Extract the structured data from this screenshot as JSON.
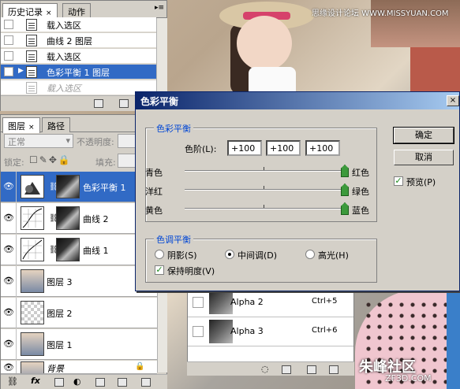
{
  "watermark": {
    "top": "思缘设计论坛 WWW.MISSYUAN.COM",
    "bottom_cn": "朱峰社区",
    "bottom_en": "ZF3D.COM"
  },
  "history": {
    "tabs": [
      {
        "label": "历史记录",
        "close": "×"
      },
      {
        "label": "动作"
      }
    ],
    "items": [
      {
        "label": "载入选区"
      },
      {
        "label": "曲线 2 图层"
      },
      {
        "label": "载入选区"
      },
      {
        "label": "色彩平衡 1 图层"
      },
      {
        "label": "载入选区"
      }
    ]
  },
  "layers": {
    "tabs": [
      {
        "label": "图层",
        "close": "×"
      },
      {
        "label": "路径"
      }
    ],
    "blend_mode": "正常",
    "opacity_label": "不透明度:",
    "lock_label": "锁定:",
    "fill_label": "填充:",
    "items": [
      {
        "name": "色彩平衡 1"
      },
      {
        "name": "曲线 2"
      },
      {
        "name": "曲线 1"
      },
      {
        "name": "图层 3"
      },
      {
        "name": "图层 2"
      },
      {
        "name": "图层 1"
      },
      {
        "name": "背景"
      }
    ]
  },
  "channels": {
    "items": [
      {
        "name": "Alpha 2",
        "shortcut": "Ctrl+5"
      },
      {
        "name": "Alpha 3",
        "shortcut": "Ctrl+6"
      }
    ]
  },
  "dialog": {
    "title": "色彩平衡",
    "close": "×",
    "balance_group": "色彩平衡",
    "levels_label": "色阶(L):",
    "levels": [
      "+100",
      "+100",
      "+100"
    ],
    "sliders": [
      {
        "left": "青色",
        "right": "红色",
        "value": 100
      },
      {
        "left": "洋红",
        "right": "绿色",
        "value": 100
      },
      {
        "left": "黄色",
        "right": "蓝色",
        "value": 100
      }
    ],
    "tone_group": "色调平衡",
    "tones": [
      {
        "label": "阴影(S)"
      },
      {
        "label": "中间调(D)",
        "selected": true
      },
      {
        "label": "高光(H)"
      }
    ],
    "preserve_label": "保持明度(V)",
    "preserve_checked": true,
    "ok_label": "确定",
    "cancel_label": "取消",
    "preview_label": "预览(P)",
    "preview_checked": true
  },
  "colors": {
    "selection": "#316ac5",
    "slider_thumb": "#3c9a3c",
    "group_title": "#0046d5"
  }
}
